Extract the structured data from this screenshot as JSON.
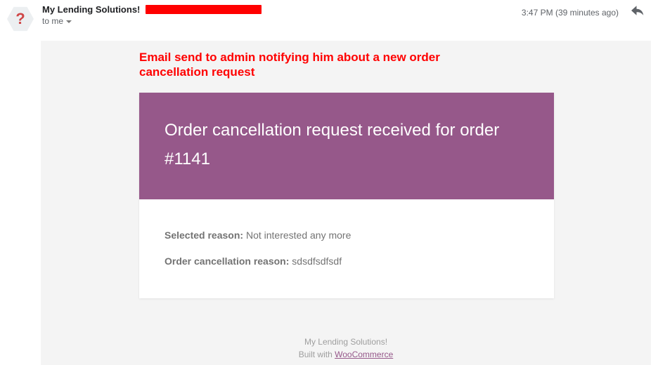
{
  "header": {
    "sender_name": "My Lending Solutions!",
    "to_text": "to me",
    "timestamp": "3:47 PM (39 minutes ago)",
    "avatar_symbol": "?"
  },
  "annotation": {
    "text": "Email send to admin notifying him about a new order cancellation request"
  },
  "card": {
    "title": "Order cancellation request received for order #1141",
    "selected_reason_label": "Selected reason:",
    "selected_reason_value": " Not interested any more",
    "cancel_reason_label": "Order cancellation reason:",
    "cancel_reason_value": " sdsdfsdfsdf"
  },
  "footer": {
    "company": "My Lending Solutions!",
    "built_prefix": "Built with ",
    "built_link": "WooCommerce"
  }
}
